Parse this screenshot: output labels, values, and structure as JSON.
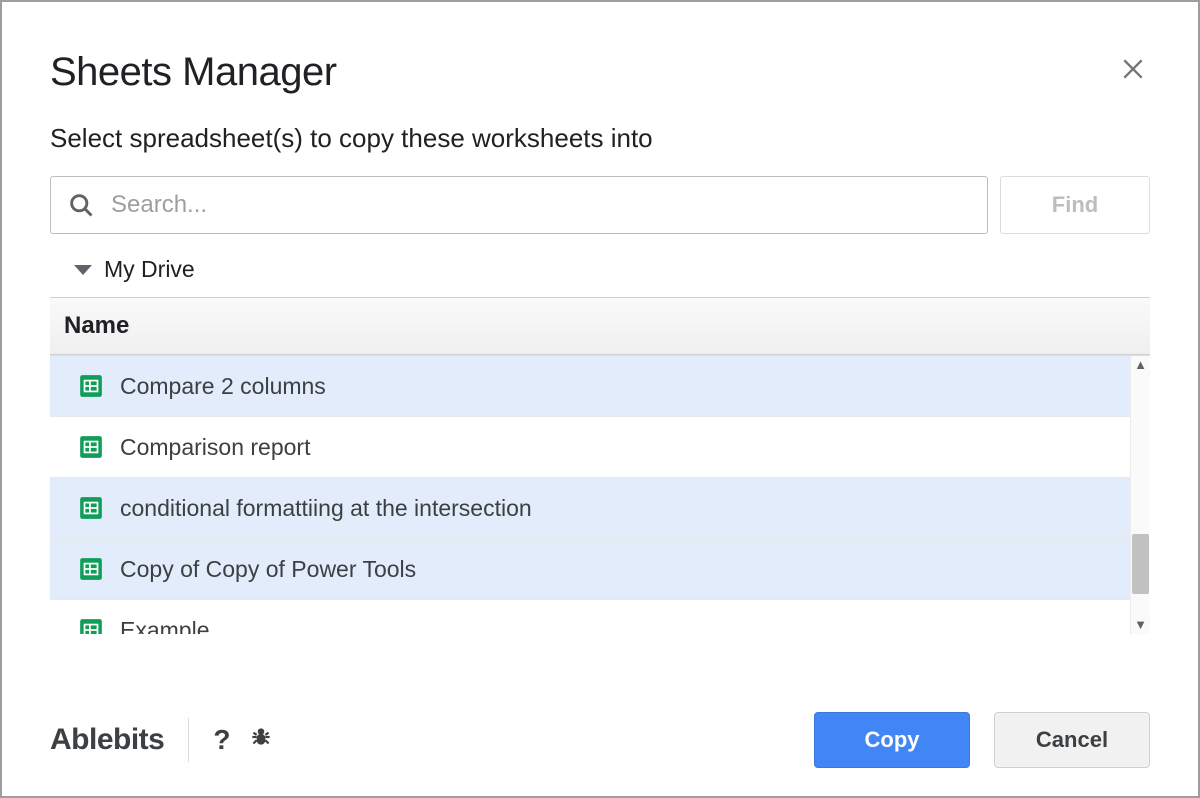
{
  "dialog": {
    "title": "Sheets Manager",
    "subtitle": "Select spreadsheet(s) to copy these worksheets into"
  },
  "search": {
    "placeholder": "Search...",
    "value": "",
    "find_label": "Find"
  },
  "breadcrumb": {
    "root": "My Drive"
  },
  "table": {
    "column_header": "Name",
    "files": [
      {
        "name": "Compare 2 columns",
        "selected": true
      },
      {
        "name": "Comparison report",
        "selected": false
      },
      {
        "name": "conditional formattiing at the intersection",
        "selected": true
      },
      {
        "name": "Copy of Copy of Power Tools",
        "selected": true
      },
      {
        "name": "Example",
        "selected": false
      }
    ]
  },
  "footer": {
    "brand": "Ablebits",
    "primary": "Copy",
    "secondary": "Cancel"
  }
}
